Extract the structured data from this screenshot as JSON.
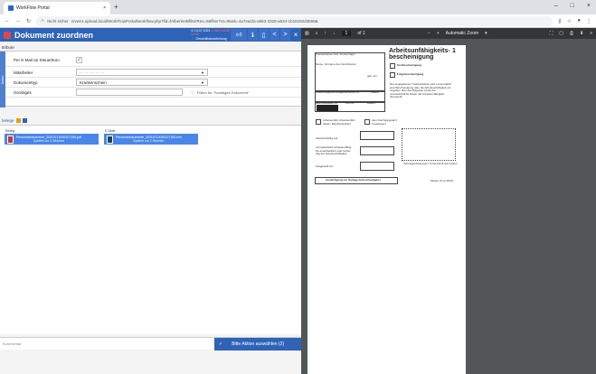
{
  "browser": {
    "tab_title": "WorkFlow Portal",
    "tab_close": "×",
    "new_tab": "+",
    "security_label": "Nicht sicher",
    "url": "srvwv1.upload.local/WorkFlowPortal/workflow.php?fid=fAlbertenBfilterRes=56filterTxt=8task=4a7ea1fa-a963-4328-a534-1b18182d3568&",
    "window_controls": [
      "–",
      "□",
      "×"
    ]
  },
  "app": {
    "title": "Dokument zuordnen",
    "date": "14.07.2021",
    "due_label": "Geschäftsbearbeitung",
    "red_info": "1 Nicht erfüllt 10:30",
    "badge": "0",
    "nav_prev": "<",
    "nav_next": ">",
    "close": "×"
  },
  "attributes": {
    "section_label": "ttribute",
    "vertical_tab": "Daten",
    "rows": [
      {
        "label": "Per E-Mail an Steuerbüro",
        "checked": true
      },
      {
        "label": "Mitarbeiter",
        "value": ""
      },
      {
        "label": "Dokumenttyp",
        "value": "Krankenschein"
      },
      {
        "label": "Sonstiges",
        "value": "",
        "hint": "Füllen für \"Sonstiges Dokument\""
      }
    ]
  },
  "belege": {
    "section_label": "belege",
    "columns": [
      {
        "head": "Beleg",
        "file": "Personaldokumente_20210714092107100.pdf",
        "sub": "System vor 2 Wochen"
      },
      {
        "head": "E-Mail",
        "file": "Personaldokumente_20210714092107100.eml",
        "sub": "System vor 2 Wochen"
      }
    ]
  },
  "footer": {
    "comment_placeholder": "Kommentar",
    "action_label": "Bitte Aktion auswählen (2)"
  },
  "pdf": {
    "page_current": "1",
    "page_total": "of 1",
    "zoom_label": "Automatic Zoom",
    "form_title": "Arbeitsunfähigkeits-bescheinigung",
    "form_number": "1",
    "erst": "Erstbescheinigung",
    "folge": "Folgebescheinigung",
    "krankenkasse": "Krankenkasse bzw. Kostenträger",
    "name": "Name, Vorname des Versicherten",
    "geb": "geb. am",
    "kasse_nr": "Kostenträgerkennung",
    "vers_nr": "Versicherten-Nr.",
    "status": "Status",
    "bsnr": "Betriebsstätten-Nr.",
    "arzt_nr": "Arzt-Nr.",
    "datum": "Datum",
    "unfall": "Arbeitsunfall, Arbeitsunfall-folgen, Berufskrankheit",
    "durchgang": "dem Durchgangsarzt zugewiesen",
    "seit": "arbeitsunfähig seit",
    "bis": "voraussichtlich arbeitsunfähig bis einschließlich oder letzter Tag der Arbeitsunfähigkeit",
    "festgestellt": "festgestellt am",
    "note": "Der angegebenen Krankenkasse wird unverzüglich eine Bescheinigung über die Arbeitsunfähigkeit mit Angaben über die Diagnose sowie die voraussichtliche Dauer der Arbeitsunfähigkeit übersandt.",
    "stamp": "Vertragsarztstempel / Unterschrift des Arztes",
    "footer_text": "Ausfertigung zur Vorlage beim Arbeitgeber",
    "muster": "Muster 1b (1.2016)"
  }
}
